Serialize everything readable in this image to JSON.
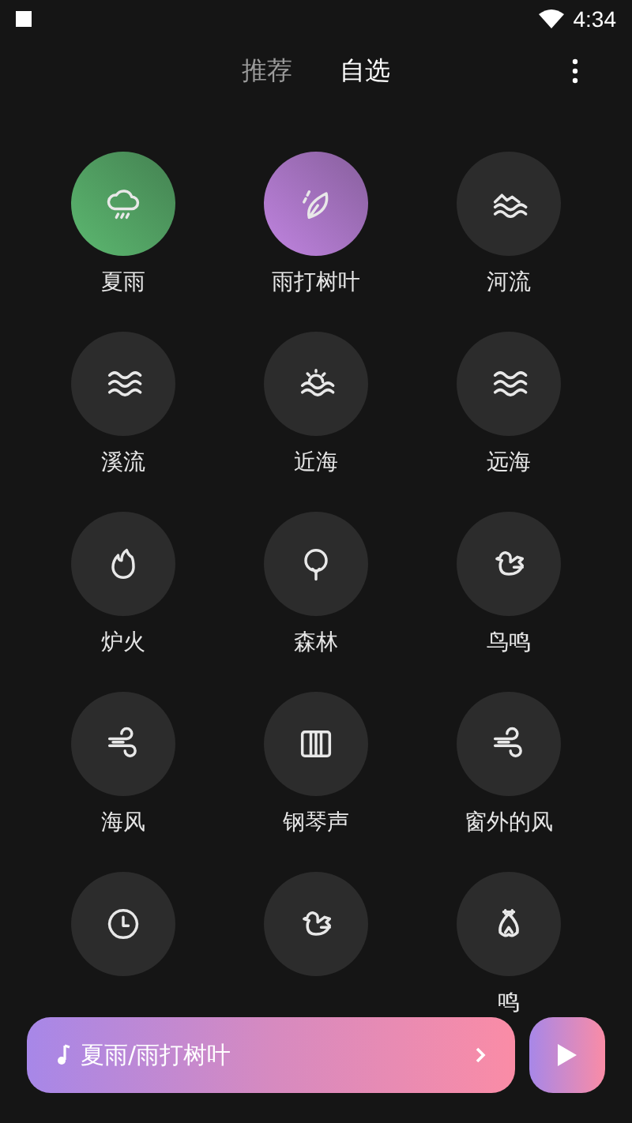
{
  "status_bar": {
    "time": "4:34"
  },
  "tabs": [
    {
      "label": "推荐",
      "selected": false
    },
    {
      "label": "自选",
      "selected": true
    }
  ],
  "sounds": [
    {
      "label": "夏雨",
      "kind": "rain",
      "selected": true,
      "color": "#5cb870"
    },
    {
      "label": "雨打树叶",
      "kind": "leaf",
      "selected": true,
      "color": "#c084e0"
    },
    {
      "label": "河流",
      "kind": "river",
      "selected": false
    },
    {
      "label": "溪流",
      "kind": "stream",
      "selected": false
    },
    {
      "label": "近海",
      "kind": "sunrise",
      "selected": false
    },
    {
      "label": "远海",
      "kind": "sea",
      "selected": false
    },
    {
      "label": "炉火",
      "kind": "fire",
      "selected": false
    },
    {
      "label": "森林",
      "kind": "tree",
      "selected": false
    },
    {
      "label": "鸟鸣",
      "kind": "bird",
      "selected": false
    },
    {
      "label": "海风",
      "kind": "wind",
      "selected": false
    },
    {
      "label": "钢琴声",
      "kind": "piano",
      "selected": false
    },
    {
      "label": "窗外的风",
      "kind": "wind",
      "selected": false
    },
    {
      "kind": "clock",
      "selected": false
    },
    {
      "kind": "bird",
      "selected": false
    },
    {
      "label": "鸣",
      "kind": "cicada",
      "selected": false
    }
  ],
  "player": {
    "title": "夏雨/雨打树叶"
  }
}
